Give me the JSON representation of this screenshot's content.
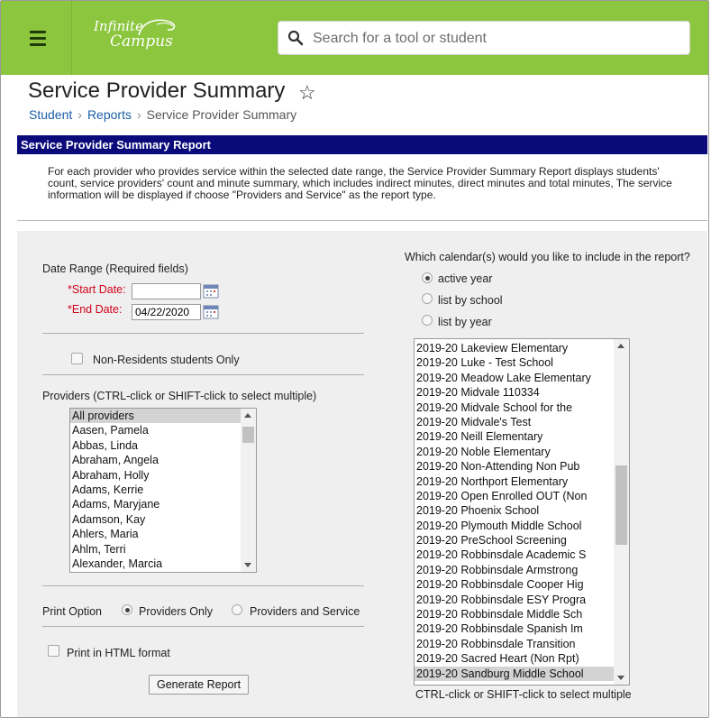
{
  "header": {
    "logo_line1": "Infinite",
    "logo_line2": "Campus",
    "search_placeholder": "Search for a tool or student",
    "page_title": "Service Provider Summary",
    "breadcrumb": [
      "Student",
      "Reports",
      "Service Provider Summary"
    ]
  },
  "report": {
    "title": "Service Provider Summary Report",
    "description": "For each provider who provides service within the selected date range, the Service Provider Summary Report displays students' count, service providers' count and minute summary, which includes indirect minutes, direct minutes and total minutes, The service information will be displayed if choose \"Providers and Service\" as the report type."
  },
  "form": {
    "date_range_label": "Date Range (Required fields)",
    "start_date_label": "*Start Date:",
    "start_date_value": "",
    "end_date_label": "*End Date:",
    "end_date_value": "04/22/2020",
    "non_residents_label": "Non-Residents students Only",
    "providers_label": "Providers (CTRL-click or SHIFT-click to select multiple)",
    "providers": [
      "All providers",
      "Aasen, Pamela",
      "Abbas, Linda",
      "Abraham, Angela",
      "Abraham, Holly",
      "Adams, Kerrie",
      "Adams, Maryjane",
      "Adamson, Kay",
      "Ahlers, Maria",
      "Ahlm, Terri",
      "Alexander, Marcia"
    ],
    "providers_selected": "All providers",
    "print_option_label": "Print Option",
    "print_options": [
      "Providers Only",
      "Providers and Service"
    ],
    "print_option_selected": "Providers Only",
    "html_format_label": "Print in HTML format",
    "generate_button": "Generate Report",
    "calendar_question": "Which calendar(s) would you like to include in the report?",
    "calendar_options": [
      "active year",
      "list by school",
      "list by year"
    ],
    "calendar_option_selected": "active year",
    "calendars": [
      "2019-20 Lakeview Elementary",
      "2019-20 Luke - Test School",
      "2019-20 Meadow Lake Elementary",
      "2019-20 Midvale 110334",
      "2019-20 Midvale School for the",
      "2019-20 Midvale's Test",
      "2019-20 Neill Elementary",
      "2019-20 Noble Elementary",
      "2019-20 Non-Attending Non Pub",
      "2019-20 Northport Elementary",
      "2019-20 Open Enrolled OUT (Non",
      "2019-20 Phoenix School",
      "2019-20 Plymouth Middle School",
      "2019-20 PreSchool Screening",
      "2019-20 Robbinsdale Academic S",
      "2019-20 Robbinsdale Armstrong",
      "2019-20 Robbinsdale Cooper Hig",
      "2019-20 Robbinsdale ESY Progra",
      "2019-20 Robbinsdale Middle Sch",
      "2019-20 Robbinsdale Spanish Im",
      "2019-20 Robbinsdale Transition",
      "2019-20 Sacred Heart (Non Rpt)",
      "2019-20 Sandburg Middle School"
    ],
    "calendars_selected": "2019-20 Sandburg Middle School",
    "calendar_hint": "CTRL-click or SHIFT-click to select multiple"
  },
  "colors": {
    "topbar": "#8cc63f",
    "report_bar": "#0a0a7a",
    "link": "#1a5ea8",
    "required": "#d0021b"
  }
}
